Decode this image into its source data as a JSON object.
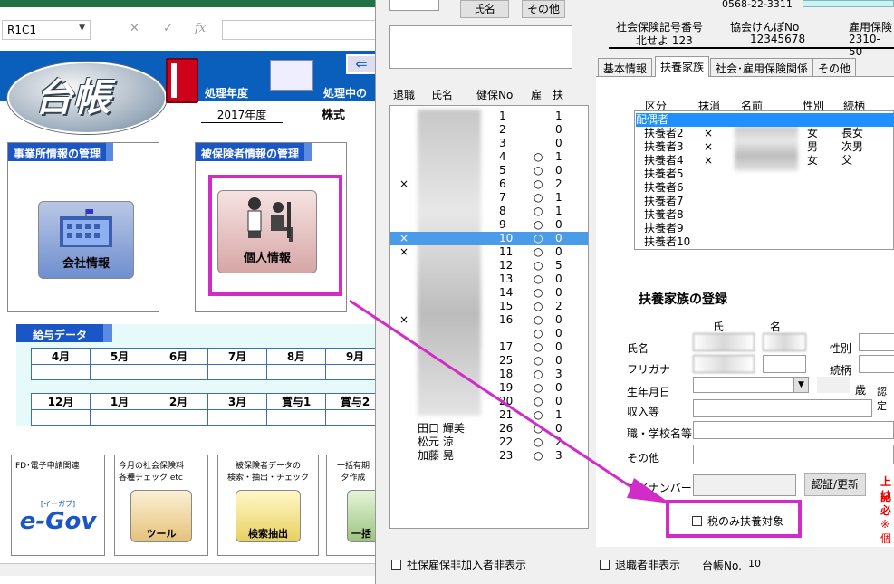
{
  "excel": {
    "namebox": "R1C1",
    "fx_symbol": "fx",
    "logo_text": "台帳",
    "processing_year_label": "処理年度",
    "processing_mid_label": "処理中の",
    "fiscal_year": "2017年度",
    "company_prefix": "株式",
    "panel_company_title": "事業所情報の管理",
    "panel_insured_title": "被保険者情報の管理",
    "btn_company": "会社情報",
    "btn_personal": "個人情報",
    "payroll_title": "給与データ",
    "months_row1": [
      "4月",
      "5月",
      "6月",
      "7月",
      "8月",
      "9月"
    ],
    "months_row2": [
      "12月",
      "1月",
      "2月",
      "3月",
      "賞与1",
      "賞与2"
    ],
    "tile1_text": "FD･電子申請関連",
    "tile1_logo": "e-Gov",
    "tile1_logo_sub": "[イーガブ]",
    "tile2_text": "今月の社会保険料\n各種チェック etc",
    "tile2_label": "ツール",
    "tile3_text": "被保険者データの\n検索・抽出・チェック",
    "tile3_label": "検索抽出",
    "tile4_text": "一括有期\n夕作成",
    "tile4_label": "一括"
  },
  "dialog": {
    "btn_name": "氏名",
    "btn_other": "その他",
    "list_headers": {
      "retired": "退職",
      "name": "氏名",
      "health_no": "健保No",
      "employ": "雇",
      "dependents": "扶"
    },
    "list_rows": [
      {
        "x": "",
        "no": "1",
        "emp": "",
        "dep": "1"
      },
      {
        "x": "",
        "no": "2",
        "emp": "",
        "dep": "0"
      },
      {
        "x": "",
        "no": "3",
        "emp": "",
        "dep": "0"
      },
      {
        "x": "",
        "no": "4",
        "emp": "○",
        "dep": "1"
      },
      {
        "x": "",
        "no": "5",
        "emp": "○",
        "dep": "0"
      },
      {
        "x": "×",
        "no": "6",
        "emp": "○",
        "dep": "2"
      },
      {
        "x": "",
        "no": "7",
        "emp": "○",
        "dep": "1"
      },
      {
        "x": "",
        "no": "8",
        "emp": "○",
        "dep": "1"
      },
      {
        "x": "",
        "no": "9",
        "emp": "○",
        "dep": "0"
      },
      {
        "x": "×",
        "no": "10",
        "emp": "○",
        "dep": "0"
      },
      {
        "x": "×",
        "no": "11",
        "emp": "○",
        "dep": "0"
      },
      {
        "x": "",
        "no": "12",
        "emp": "○",
        "dep": "5"
      },
      {
        "x": "",
        "no": "13",
        "emp": "○",
        "dep": "0"
      },
      {
        "x": "",
        "no": "14",
        "emp": "○",
        "dep": "0"
      },
      {
        "x": "",
        "no": "15",
        "emp": "○",
        "dep": "2"
      },
      {
        "x": "×",
        "no": "16",
        "emp": "○",
        "dep": "0"
      },
      {
        "x": "",
        "no": "",
        "emp": "○",
        "dep": "0"
      },
      {
        "x": "",
        "no": "17",
        "emp": "○",
        "dep": "0"
      },
      {
        "x": "",
        "no": "25",
        "emp": "○",
        "dep": "0"
      },
      {
        "x": "",
        "no": "18",
        "emp": "○",
        "dep": "3"
      },
      {
        "x": "",
        "no": "19",
        "emp": "○",
        "dep": "0"
      },
      {
        "x": "",
        "no": "20",
        "emp": "○",
        "dep": "0"
      },
      {
        "x": "",
        "no": "21",
        "emp": "○",
        "dep": "1"
      },
      {
        "x": "",
        "name": "田口 輝美",
        "no": "26",
        "emp": "○",
        "dep": "0"
      },
      {
        "x": "",
        "name": "松元 涼",
        "no": "22",
        "emp": "○",
        "dep": "2"
      },
      {
        "x": "",
        "name": "加藤 晃",
        "no": "23",
        "emp": "○",
        "dep": "3"
      }
    ],
    "selected_row_index": 9,
    "checkbox_hide_nonmember": "社保雇保非加入者非表示",
    "phone": "0568-22-3311",
    "ins_symbol_label": "社会保険記号番号",
    "ins_symbol_value": "北せよ 123",
    "kyokai_label": "協会けんぽNo",
    "kyokai_value": "12345678",
    "employment_label": "雇用保険",
    "employment_value": "2310-50",
    "tabs": [
      "基本情報",
      "扶養家族",
      "社会･雇用保険関係",
      "その他"
    ],
    "active_tab": 1,
    "dep_headers": {
      "kubun": "区分",
      "delete": "抹消",
      "name": "名前",
      "sex": "性別",
      "relation": "続柄"
    },
    "dep_rows": [
      {
        "kubun": "配偶者",
        "del": "",
        "sex": "",
        "rel": ""
      },
      {
        "kubun": "扶養者2",
        "del": "×",
        "sex": "女",
        "rel": "長女"
      },
      {
        "kubun": "扶養者3",
        "del": "×",
        "sex": "男",
        "rel": "次男"
      },
      {
        "kubun": "扶養者4",
        "del": "×",
        "sex": "女",
        "rel": "父"
      },
      {
        "kubun": "扶養者5",
        "del": "",
        "sex": "",
        "rel": ""
      },
      {
        "kubun": "扶養者6",
        "del": "",
        "sex": "",
        "rel": ""
      },
      {
        "kubun": "扶養者7",
        "del": "",
        "sex": "",
        "rel": ""
      },
      {
        "kubun": "扶養者8",
        "del": "",
        "sex": "",
        "rel": ""
      },
      {
        "kubun": "扶養者9",
        "del": "",
        "sex": "",
        "rel": ""
      },
      {
        "kubun": "扶養者10",
        "del": "",
        "sex": "",
        "rel": ""
      }
    ],
    "reg_title": "扶養家族の登録",
    "col_surname": "氏",
    "col_given": "名",
    "lbl_name": "氏名",
    "lbl_furigana": "フリガナ",
    "lbl_sex": "性別",
    "lbl_relation": "続柄",
    "lbl_birth": "生年月日",
    "lbl_age": "歳",
    "lbl_cert": "認定",
    "lbl_income": "収入等",
    "lbl_job": "職・学校名等",
    "lbl_other": "その他",
    "lbl_mynumber": "マイナンバー",
    "btn_cert_update": "認証/更新",
    "red_note1": "上記",
    "red_note2": "は必",
    "red_note3": "※個",
    "checkbox_tax_only": "税のみ扶養対象",
    "checkbox_hide_retired": "退職者非表示",
    "ledger_no_label": "台帳No.",
    "ledger_no_value": "10"
  },
  "colors": {
    "accent_magenta": "#d22cc8",
    "selection_blue": "#4a9ce8",
    "header_blue": "#0a5fbd",
    "excel_green": "#217346"
  }
}
